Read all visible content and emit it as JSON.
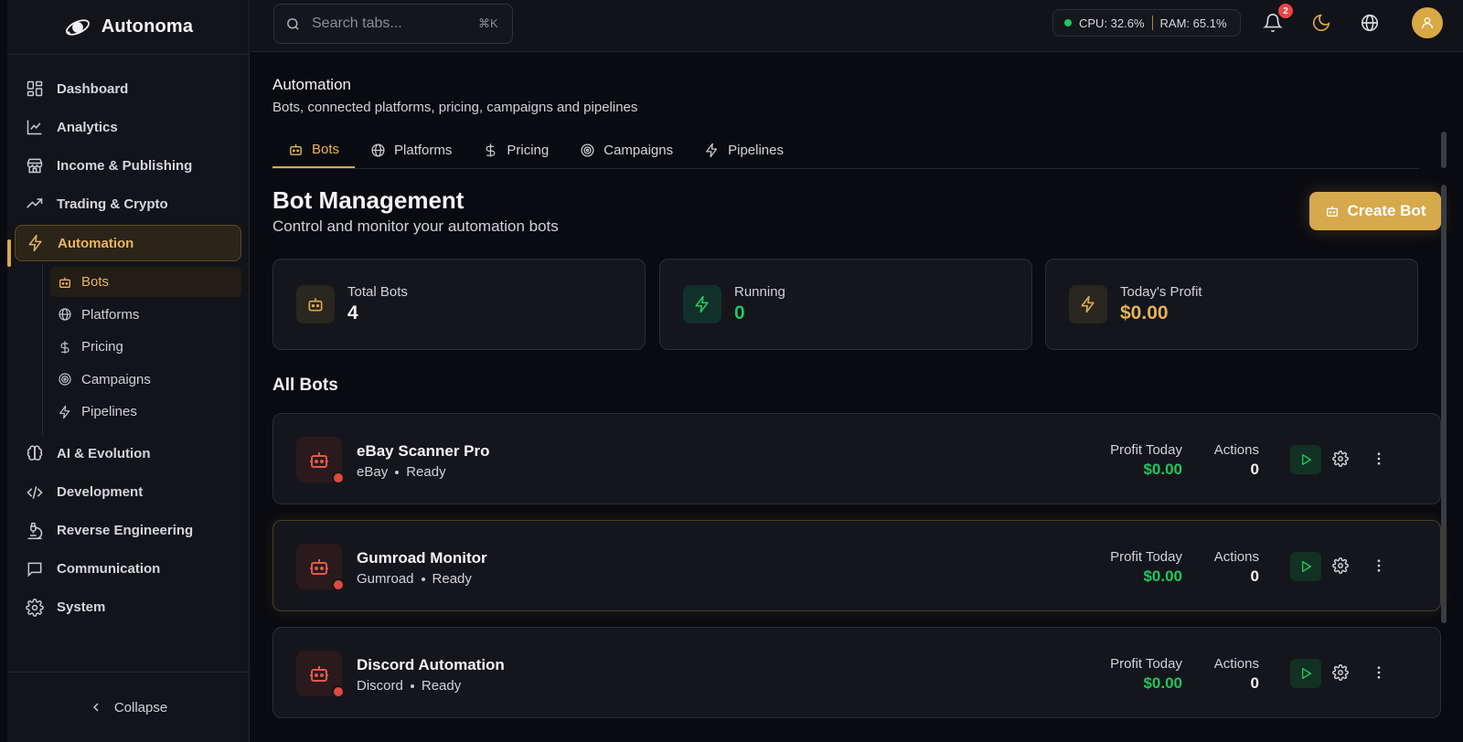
{
  "app": {
    "name": "Autonoma"
  },
  "sidebar": {
    "items": [
      {
        "label": "Dashboard",
        "icon": "dashboard-icon"
      },
      {
        "label": "Analytics",
        "icon": "chart-line-icon"
      },
      {
        "label": "Income & Publishing",
        "icon": "store-icon"
      },
      {
        "label": "Trading & Crypto",
        "icon": "trending-up-icon"
      },
      {
        "label": "Automation",
        "icon": "bolt-icon",
        "active": true
      },
      {
        "label": "AI & Evolution",
        "icon": "brain-icon"
      },
      {
        "label": "Development",
        "icon": "code-icon"
      },
      {
        "label": "Reverse Engineering",
        "icon": "microscope-icon"
      },
      {
        "label": "Communication",
        "icon": "message-icon"
      },
      {
        "label": "System",
        "icon": "gear-icon"
      }
    ],
    "sub_items": [
      {
        "label": "Bots",
        "icon": "bot-icon",
        "active": true
      },
      {
        "label": "Platforms",
        "icon": "globe-icon"
      },
      {
        "label": "Pricing",
        "icon": "dollar-icon"
      },
      {
        "label": "Campaigns",
        "icon": "target-icon"
      },
      {
        "label": "Pipelines",
        "icon": "bolt-icon"
      }
    ],
    "collapse_label": "Collapse"
  },
  "topbar": {
    "search_placeholder": "Search tabs...",
    "search_shortcut": "⌘K",
    "cpu": "CPU: 32.6%",
    "ram": "RAM: 65.1%",
    "notification_count": "2"
  },
  "page": {
    "title": "Automation",
    "subtitle": "Bots, connected platforms, pricing, campaigns and pipelines",
    "tabs": [
      {
        "label": "Bots",
        "icon": "bot-icon",
        "active": true
      },
      {
        "label": "Platforms",
        "icon": "globe-icon"
      },
      {
        "label": "Pricing",
        "icon": "dollar-icon"
      },
      {
        "label": "Campaigns",
        "icon": "target-icon"
      },
      {
        "label": "Pipelines",
        "icon": "bolt-icon"
      }
    ]
  },
  "bot_management": {
    "title": "Bot Management",
    "subtitle": "Control and monitor your automation bots",
    "create_label": "Create Bot",
    "stats": [
      {
        "label": "Total Bots",
        "value": "4"
      },
      {
        "label": "Running",
        "value": "0"
      },
      {
        "label": "Today's Profit",
        "value": "$0.00"
      }
    ],
    "all_bots_title": "All Bots",
    "profit_label": "Profit Today",
    "actions_label": "Actions",
    "bots": [
      {
        "name": "eBay Scanner Pro",
        "platform": "eBay",
        "status": "Ready",
        "profit": "$0.00",
        "actions": "0"
      },
      {
        "name": "Gumroad Monitor",
        "platform": "Gumroad",
        "status": "Ready",
        "profit": "$0.00",
        "actions": "0"
      },
      {
        "name": "Discord Automation",
        "platform": "Discord",
        "status": "Ready",
        "profit": "$0.00",
        "actions": "0"
      }
    ]
  },
  "colors": {
    "accent": "#d9a84a",
    "success": "#22c55e",
    "danger": "#e04a3c"
  }
}
